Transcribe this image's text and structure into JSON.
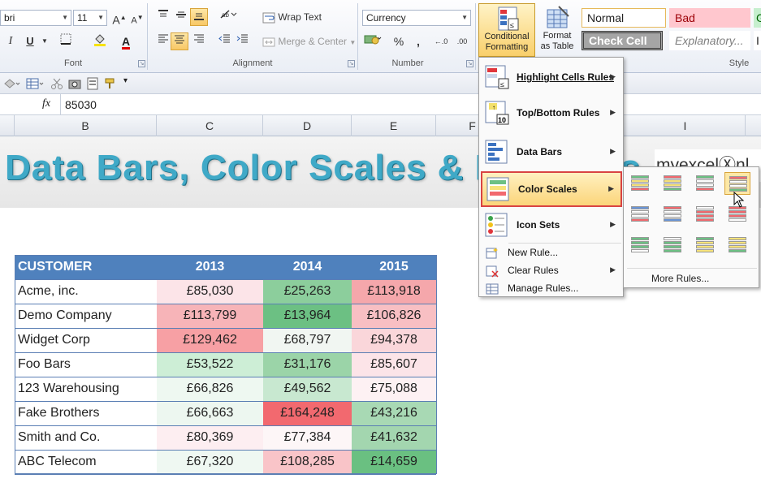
{
  "ribbon": {
    "font_name": "bri",
    "font_size": "11",
    "font_grow": "A",
    "font_shrink": "A",
    "italic": "I",
    "underline": "U",
    "font_group_label": "Font",
    "wrap_text": "Wrap Text",
    "merge_center": "Merge & Center",
    "alignment_group_label": "Alignment",
    "number_format": "Currency",
    "percent": "%",
    "comma": ",",
    "inc_dec": "←.0",
    "dec_dec": ".00",
    "number_group_label": "Number",
    "conditional_formatting": "Conditional\nFormatting",
    "format_as_table": "Format\nas Table",
    "styles_group_label": "Style",
    "cell_styles": {
      "normal": "Normal",
      "bad": "Bad",
      "good_partial": "G",
      "check_cell": "Check Cell",
      "explanatory": "Explanatory...",
      "extra": "I"
    }
  },
  "formula_bar": {
    "fx": "fx",
    "value": "85030"
  },
  "columns": [
    "B",
    "C",
    "D",
    "E",
    "F",
    "I"
  ],
  "banner": {
    "title": "Data Bars, Color Scales & Icon Sets",
    "logo": "myexcelⓍnl"
  },
  "table": {
    "headers": [
      "CUSTOMER",
      "2013",
      "2014",
      "2015"
    ],
    "rows": [
      {
        "customer": "Acme, inc.",
        "v2013": "£85,030",
        "v2014": "£25,263",
        "v2015": "£113,918",
        "c2013": "#fce4e8",
        "c2014": "#8cce9c",
        "c2015": "#f5a7ab"
      },
      {
        "customer": "Demo Company",
        "v2013": "£113,799",
        "v2014": "£13,964",
        "v2015": "£106,826",
        "c2013": "#f7b4b8",
        "c2014": "#6cc083",
        "c2015": "#f8bfc3"
      },
      {
        "customer": "Widget Corp",
        "v2013": "£129,462",
        "v2014": "£68,797",
        "v2015": "£94,378",
        "c2013": "#f7a0a4",
        "c2014": "#f1f6f2",
        "c2015": "#fad6da"
      },
      {
        "customer": "Foo Bars",
        "v2013": "£53,522",
        "v2014": "£31,176",
        "v2015": "£85,607",
        "c2013": "#cdeed6",
        "c2014": "#9bd4a8",
        "c2015": "#fce4e8"
      },
      {
        "customer": "123 Warehousing",
        "v2013": "£66,826",
        "v2014": "£49,562",
        "v2015": "£75,088",
        "c2013": "#eef8f1",
        "c2014": "#c8e8d0",
        "c2015": "#fdf1f3"
      },
      {
        "customer": "Fake Brothers",
        "v2013": "£66,663",
        "v2014": "£164,248",
        "v2015": "£43,216",
        "c2013": "#edf7f0",
        "c2014": "#f2696f",
        "c2015": "#a8d9b4"
      },
      {
        "customer": "Smith and Co.",
        "v2013": "£80,369",
        "v2014": "£77,384",
        "v2015": "£41,632",
        "c2013": "#fdeef1",
        "c2014": "#fdf6f7",
        "c2015": "#a3d6af"
      },
      {
        "customer": "ABC Telecom",
        "v2013": "£67,320",
        "v2014": "£108,285",
        "v2015": "£14,659",
        "c2013": "#eff8f2",
        "c2014": "#f9c4c8",
        "c2015": "#6ac081"
      }
    ]
  },
  "menu": {
    "items": [
      {
        "label": "Highlight Cells Rules",
        "icon": "highlight-cells-icon"
      },
      {
        "label": "Top/Bottom Rules",
        "icon": "top-bottom-icon"
      },
      {
        "label": "Data Bars",
        "icon": "data-bars-icon"
      },
      {
        "label": "Color Scales",
        "icon": "color-scales-icon"
      },
      {
        "label": "Icon Sets",
        "icon": "icon-sets-icon"
      }
    ],
    "new_rule": "New Rule...",
    "clear_rules": "Clear Rules",
    "manage_rules": "Manage Rules..."
  },
  "submenu": {
    "more_rules": "More Rules..."
  },
  "colors": {
    "header_blue": "#4f81bd",
    "highlight_red": "#d94343",
    "banner_text": "#3fa9c7"
  }
}
